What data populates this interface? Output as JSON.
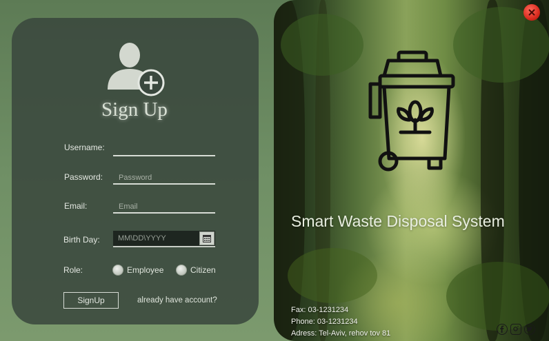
{
  "form": {
    "title": "Sign Up",
    "username": {
      "label": "Username:",
      "placeholder": ""
    },
    "password": {
      "label": "Password:",
      "placeholder": "Password"
    },
    "email": {
      "label": "Email:",
      "placeholder": "Email"
    },
    "birthday": {
      "label": "Birth Day:",
      "placeholder": "MM\\DD\\YYYY"
    },
    "role": {
      "label": "Role:",
      "options": [
        "Employee",
        "Citizen"
      ]
    },
    "submit_label": "SignUp",
    "login_link": "already have account?"
  },
  "brand": {
    "name": "Smart Waste Disposal System"
  },
  "contact": {
    "fax": "Fax: 03-1231234",
    "phone": "Phone: 03-1231234",
    "address": "Adress: Tel-Aviv, rehov tov 81"
  },
  "icons": {
    "avatar": "user-add-icon",
    "logo": "eco-trash-bin-icon",
    "close": "close-icon",
    "calendar": "calendar-icon",
    "social": [
      "facebook-icon",
      "instagram-icon",
      "twitter-icon"
    ]
  },
  "colors": {
    "card": "#3a483e",
    "close_button": "#d92b1f",
    "brand_text": "#e8eee0"
  }
}
